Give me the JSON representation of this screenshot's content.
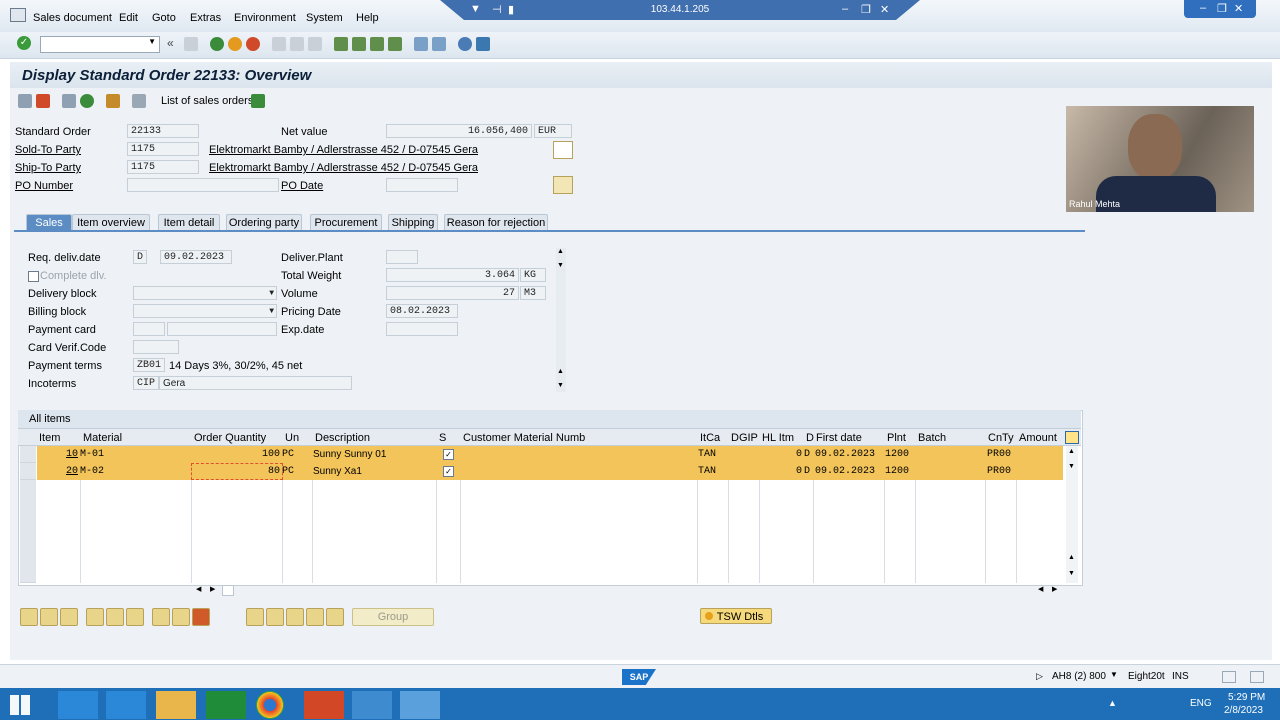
{
  "menu": [
    "Sales document",
    "Edit",
    "Goto",
    "Extras",
    "Environment",
    "System",
    "Help"
  ],
  "remote": {
    "ip": "103.44.1.205"
  },
  "title": "Display Standard Order 22133: Overview",
  "app_toolbar": {
    "list_label": "List of sales orders"
  },
  "header": {
    "standard_order_label": "Standard Order",
    "standard_order": "22133",
    "net_value_label": "Net value",
    "net_value": "16.056,400",
    "currency": "EUR",
    "sold_to_label": "Sold-To Party",
    "sold_to": "1175",
    "sold_to_addr": "Elektromarkt Bamby / Adlerstrasse 452 / D-07545 Gera",
    "ship_to_label": "Ship-To Party",
    "ship_to": "1175",
    "ship_to_addr": "Elektromarkt Bamby / Adlerstrasse 452 / D-07545 Gera",
    "po_number_label": "PO Number",
    "po_date_label": "PO Date"
  },
  "tabs": [
    "Sales",
    "Item overview",
    "Item detail",
    "Ordering party",
    "Procurement",
    "Shipping",
    "Reason for rejection"
  ],
  "sales": {
    "req_deliv_label": "Req. deliv.date",
    "req_deliv_type": "D",
    "req_deliv": "09.02.2023",
    "complete_dlv_label": "Complete dlv.",
    "delivery_block_label": "Delivery block",
    "billing_block_label": "Billing block",
    "payment_card_label": "Payment card",
    "card_verif_label": "Card Verif.Code",
    "payment_terms_label": "Payment terms",
    "payment_terms": "ZB01",
    "payment_terms_text": "14 Days 3%, 30/2%, 45 net",
    "incoterms_label": "Incoterms",
    "incoterms": "CIP",
    "incoterms_place": "Gera",
    "deliver_plant_label": "Deliver.Plant",
    "total_weight_label": "Total Weight",
    "total_weight": "3.064",
    "weight_unit": "KG",
    "volume_label": "Volume",
    "volume": "27",
    "volume_unit": "M3",
    "pricing_date_label": "Pricing Date",
    "pricing_date": "08.02.2023",
    "exp_date_label": "Exp.date"
  },
  "items_table": {
    "title": "All items",
    "columns": [
      "Item",
      "Material",
      "Order Quantity",
      "Un",
      "Description",
      "S",
      "Customer Material Numb",
      "ItCa",
      "DGIP",
      "HL Itm",
      "D",
      "First date",
      "Plnt",
      "Batch",
      "CnTy",
      "Amount"
    ],
    "rows": [
      {
        "item": "10",
        "material": "M-01",
        "qty": "100",
        "un": "PC",
        "desc": "Sunny Sunny 01",
        "itca": "TAN",
        "hl": "0",
        "d": "D",
        "first_date": "09.02.2023",
        "plnt": "1200",
        "cnty": "PR00"
      },
      {
        "item": "20",
        "material": "M-02",
        "qty": "80",
        "un": "PC",
        "desc": "Sunny Xa1",
        "itca": "TAN",
        "hl": "0",
        "d": "D",
        "first_date": "09.02.2023",
        "plnt": "1200",
        "cnty": "PR00"
      }
    ]
  },
  "bottom_buttons": {
    "group": "Group",
    "tsw": "TSW Dtls"
  },
  "status": {
    "system": "AH8 (2) 800",
    "server": "Eight20t",
    "mode": "INS"
  },
  "webcam": {
    "name": "Rahul Mehta"
  },
  "taskbar": {
    "lang": "ENG",
    "time": "5:29 PM",
    "date": "2/8/2023"
  }
}
